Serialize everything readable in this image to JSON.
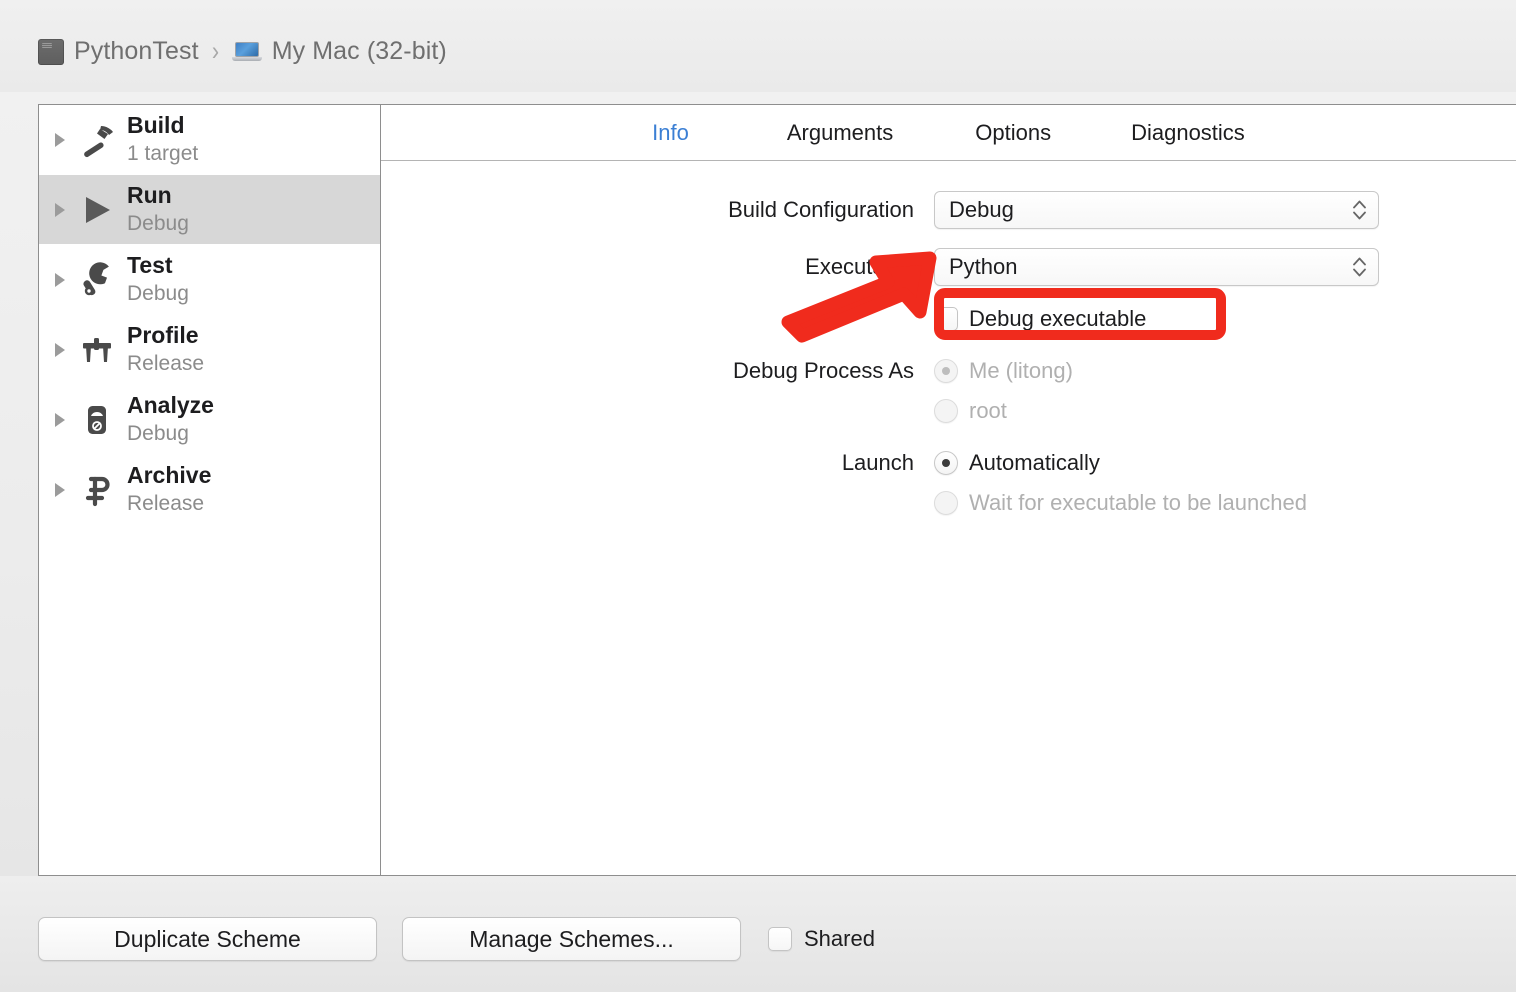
{
  "header": {
    "project": "PythonTest",
    "separator": "›",
    "destination": "My Mac (32-bit)",
    "project_icon": "project-icon",
    "destination_icon": "macbook-icon"
  },
  "sidebar": {
    "items": [
      {
        "title": "Build",
        "subtitle": "1 target",
        "icon": "hammer-icon",
        "selected": false
      },
      {
        "title": "Run",
        "subtitle": "Debug",
        "icon": "play-icon",
        "selected": true
      },
      {
        "title": "Test",
        "subtitle": "Debug",
        "icon": "wrench-icon",
        "selected": false
      },
      {
        "title": "Profile",
        "subtitle": "Release",
        "icon": "caliper-icon",
        "selected": false
      },
      {
        "title": "Analyze",
        "subtitle": "Debug",
        "icon": "gauge-icon",
        "selected": false
      },
      {
        "title": "Archive",
        "subtitle": "Release",
        "icon": "clamp-icon",
        "selected": false
      }
    ]
  },
  "tabs": [
    {
      "label": "Info",
      "active": true
    },
    {
      "label": "Arguments",
      "active": false
    },
    {
      "label": "Options",
      "active": false
    },
    {
      "label": "Diagnostics",
      "active": false
    }
  ],
  "form": {
    "build_configuration": {
      "label": "Build Configuration",
      "value": "Debug"
    },
    "executable": {
      "label": "Executable",
      "value": "Python"
    },
    "debug_executable": {
      "label": "Debug executable",
      "checked": false
    },
    "debug_process_as": {
      "label": "Debug Process As",
      "options": [
        {
          "label": "Me (litong)",
          "selected": true,
          "disabled": true
        },
        {
          "label": "root",
          "selected": false,
          "disabled": true
        }
      ]
    },
    "launch": {
      "label": "Launch",
      "options": [
        {
          "label": "Automatically",
          "selected": true,
          "disabled": false
        },
        {
          "label": "Wait for executable to be launched",
          "selected": false,
          "disabled": true
        }
      ]
    }
  },
  "bottom": {
    "duplicate_scheme": "Duplicate Scheme",
    "manage_schemes": "Manage Schemes...",
    "shared_label": "Shared",
    "shared_checked": false
  },
  "annotations": {
    "color": "#F02B1D",
    "highlight_target": "Debug executable",
    "arrow_points_to": "Executable"
  },
  "colors": {
    "accent_blue": "#3B7FD4",
    "annotation_red": "#F02B1D",
    "selected_row": "#D7D7D7",
    "text_primary": "#1D1D1F",
    "text_secondary": "#8B8B8B",
    "text_disabled": "#B0B0B0"
  }
}
